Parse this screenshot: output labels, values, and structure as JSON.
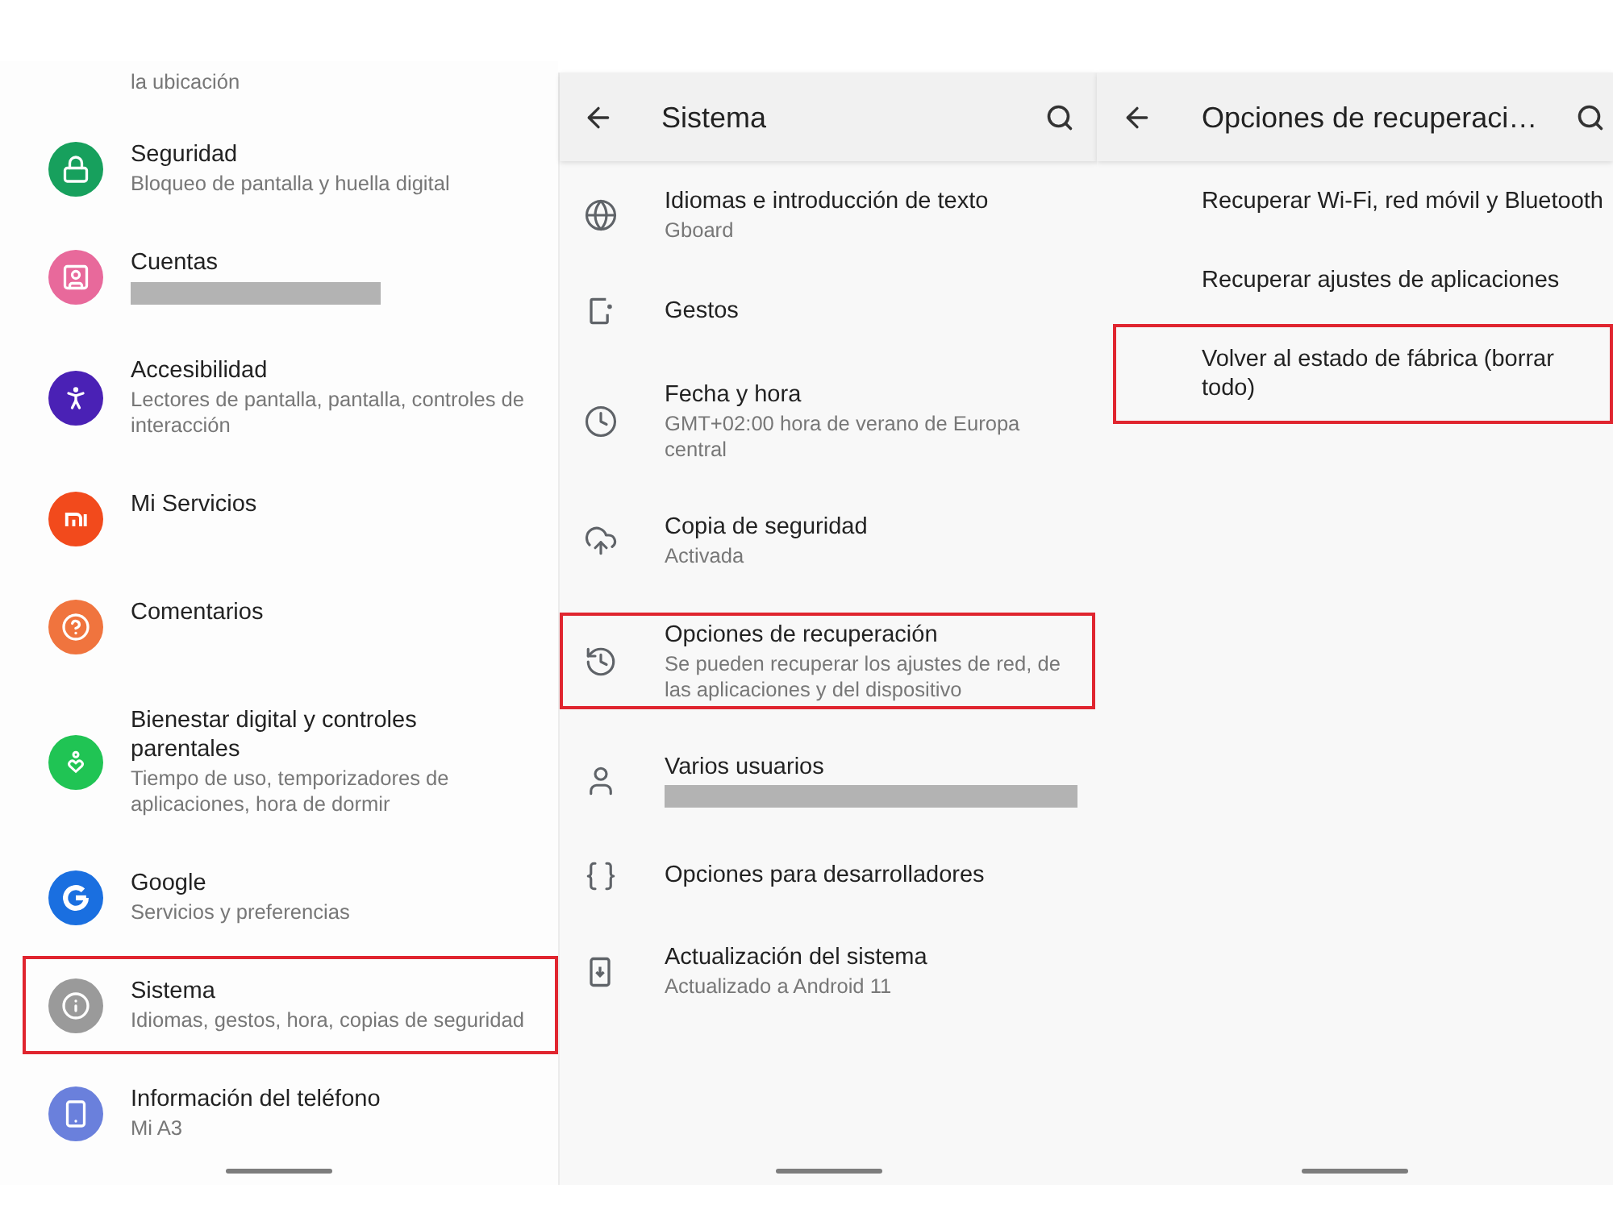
{
  "settings_panel": {
    "top_cut_text": "la ubicación",
    "items": [
      {
        "title": "Seguridad",
        "subtitle": "Bloqueo de pantalla y huella digital",
        "color": "#17a05d",
        "redacted": false,
        "highlighted": false
      },
      {
        "title": "Cuentas",
        "color": "#e8699b",
        "redacted": true,
        "highlighted": false
      },
      {
        "title": "Accesibilidad",
        "subtitle": "Lectores de pantalla, pantalla, controles de interacción",
        "color": "#4a21b5",
        "redacted": false,
        "highlighted": false
      },
      {
        "title": "Mi Servicios",
        "color": "#f24a1c",
        "redacted": false,
        "highlighted": false
      },
      {
        "title": "Comentarios",
        "color": "#f0743e",
        "redacted": false,
        "highlighted": false
      },
      {
        "title": "Bienestar digital y controles parentales",
        "subtitle": "Tiempo de uso, temporizadores de aplicaciones, hora de dormir",
        "color": "#20c454",
        "redacted": false,
        "highlighted": false
      },
      {
        "title": "Google",
        "subtitle": "Servicios y preferencias",
        "color": "#1a6fe0",
        "redacted": false,
        "highlighted": false
      },
      {
        "title": "Sistema",
        "subtitle": "Idiomas, gestos, hora, copias de seguridad",
        "color": "#9a9a9a",
        "redacted": false,
        "highlighted": true
      },
      {
        "title": "Información del teléfono",
        "subtitle": "Mi A3",
        "color": "#6a80dc",
        "redacted": false,
        "highlighted": false
      }
    ]
  },
  "system_panel": {
    "title": "Sistema",
    "items": [
      {
        "title": "Idiomas e introducción de texto",
        "subtitle": "Gboard",
        "redacted": false,
        "highlighted": false
      },
      {
        "title": "Gestos",
        "redacted": false,
        "highlighted": false
      },
      {
        "title": "Fecha y hora",
        "subtitle": "GMT+02:00 hora de verano de Europa central",
        "redacted": false,
        "highlighted": false
      },
      {
        "title": "Copia de seguridad",
        "subtitle": "Activada",
        "redacted": false,
        "highlighted": false
      },
      {
        "title": "Opciones de recuperación",
        "subtitle": "Se pueden recuperar los ajustes de red, de las aplicaciones y del dispositivo",
        "redacted": false,
        "highlighted": true
      },
      {
        "title": "Varios usuarios",
        "redacted": true,
        "highlighted": false
      },
      {
        "title": "Opciones para desarrolladores",
        "redacted": false,
        "highlighted": false
      },
      {
        "title": "Actualización del sistema",
        "subtitle": "Actualizado a Android 11",
        "redacted": false,
        "highlighted": false
      }
    ]
  },
  "recovery_panel": {
    "title": "Opciones de recuperaci…",
    "items": [
      {
        "title": "Recuperar Wi-Fi, red móvil y Bluetooth",
        "highlighted": false
      },
      {
        "title": "Recuperar ajustes de aplicaciones",
        "highlighted": false
      },
      {
        "title": "Volver al estado de fábrica (borrar todo)",
        "highlighted": true
      }
    ]
  }
}
